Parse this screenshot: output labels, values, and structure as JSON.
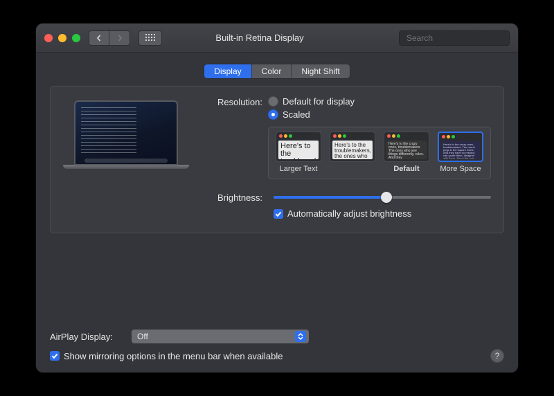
{
  "window": {
    "title": "Built-in Retina Display"
  },
  "search": {
    "placeholder": "Search"
  },
  "tabs": {
    "display": "Display",
    "color": "Color",
    "night_shift": "Night Shift"
  },
  "resolution": {
    "label": "Resolution:",
    "default_for_display": "Default for display",
    "scaled": "Scaled",
    "selected": "scaled"
  },
  "scaled_options": {
    "thumb_samples": {
      "s1": "Here's to the troublemakers",
      "s2": "Here's to the troublemakers, the ones who",
      "s3": "Here's to the crazy ones, troublemakers. The ones who see things differently, rules. And they",
      "s4": "Here's to the crazy ones, troublemakers. The round pegs in the square holes. And they have no respect, can quote them, disagree with them. About the only thing. Because they change things."
    },
    "larger_text": "Larger Text",
    "default": "Default",
    "more_space": "More Space"
  },
  "brightness": {
    "label": "Brightness:",
    "auto_label": "Automatically adjust brightness",
    "auto_checked": true
  },
  "airplay": {
    "label": "AirPlay Display:",
    "value": "Off"
  },
  "mirroring": {
    "label": "Show mirroring options in the menu bar when available",
    "checked": true
  },
  "help": "?"
}
